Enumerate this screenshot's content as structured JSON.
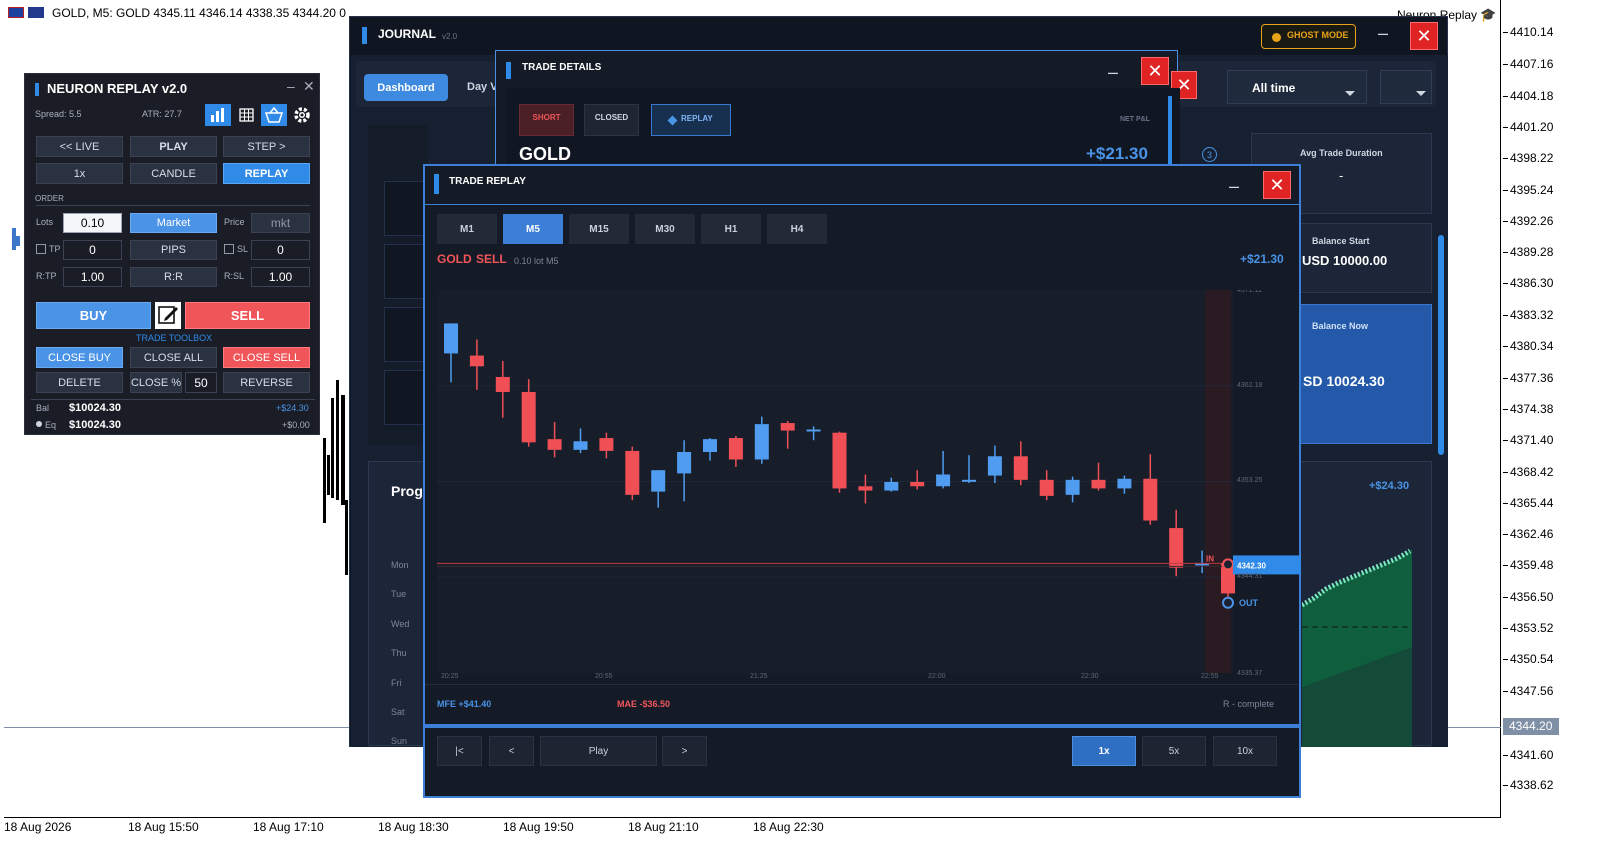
{
  "mt": {
    "title": "GOLD, M5:  GOLD  4345.11 4346.14 4338.35 4344.20  0",
    "corner_label": "Neuron Replay",
    "current_price": "4344.20",
    "price_ticks": [
      "4410.14",
      "4407.16",
      "4404.18",
      "4401.20",
      "4398.22",
      "4395.24",
      "4392.26",
      "4389.28",
      "4386.30",
      "4383.32",
      "4380.34",
      "4377.36",
      "4374.38",
      "4371.40",
      "4368.42",
      "4365.44",
      "4362.46",
      "4359.48",
      "4356.50",
      "4353.52",
      "4350.54",
      "4347.56",
      "4341.60",
      "4338.62"
    ],
    "time_ticks": [
      "18 Aug 2026",
      "18 Aug 15:50",
      "18 Aug 17:10",
      "18 Aug 18:30",
      "18 Aug 19:50",
      "18 Aug 21:10",
      "18 Aug 22:30"
    ]
  },
  "neuron": {
    "title": "NEURON REPLAY v2.0",
    "spread": "Spread: 5.5",
    "atr": "ATR: 27.7",
    "btn_live": "<< LIVE",
    "btn_play": "PLAY",
    "btn_step": "STEP >",
    "btn_speed": "1x",
    "btn_candle": "CANDLE",
    "btn_replay": "REPLAY",
    "order_label": "ORDER",
    "lots_label": "Lots",
    "lots_value": "0.10",
    "market_btn": "Market",
    "price_label": "Price",
    "price_value": "mkt",
    "tp_label": "TP",
    "tp_value": "0",
    "pips_btn": "PIPS",
    "sl_label": "SL",
    "sl_value": "0",
    "rtp_label": "R:TP",
    "rtp_value": "1.00",
    "rr_btn": "R:R",
    "rsl_label": "R:SL",
    "rsl_value": "1.00",
    "buy": "BUY",
    "sell": "SELL",
    "toolbox": "TRADE TOOLBOX",
    "close_buy": "CLOSE BUY",
    "close_all": "CLOSE ALL",
    "close_sell": "CLOSE SELL",
    "delete": "DELETE",
    "close_pct": "CLOSE %",
    "close_pct_value": "50",
    "reverse": "REVERSE",
    "bal_label": "Bal",
    "bal_value": "$10024.30",
    "bal_pnl": "+$24.30",
    "eq_label": "Eq",
    "eq_value": "$10024.30",
    "eq_pnl": "+$0.00"
  },
  "journal": {
    "title": "JOURNAL",
    "version": "v2.0",
    "ghost_mode": "GHOST MODE",
    "tab_dashboard": "Dashboard",
    "tab_day": "Day V",
    "period": "All time",
    "avg_trade_duration_label": "Avg Trade Duration",
    "avg_trade_duration_value": "-",
    "balance_start_label": "Balance Start",
    "balance_start_value": "USD 10000.00",
    "balance_now_label": "Balance Now",
    "balance_now_value": "SD 10024.30",
    "progress_label": "Prog",
    "days": [
      "Mon",
      "Tue",
      "Wed",
      "Thu",
      "Fri",
      "Sat",
      "Sun"
    ],
    "equity_pnl": "+$24.30",
    "badge_count": "3"
  },
  "details": {
    "title": "TRADE DETAILS",
    "tag_short": "SHORT",
    "tag_closed": "CLOSED",
    "tag_replay": "REPLAY",
    "net_pnl_label": "NET P&L",
    "symbol": "GOLD",
    "net_pnl": "+$21.30"
  },
  "replay": {
    "title": "TRADE REPLAY",
    "timeframes": [
      "M1",
      "M5",
      "M15",
      "M30",
      "H1",
      "H4"
    ],
    "active_tf": "M5",
    "header_symbol": "GOLD",
    "header_side": "SELL",
    "header_meta": "0.10 lot  M5",
    "header_pnl": "+$21.30",
    "mfe": "MFE +$41.40",
    "mae": "MAE -$36.50",
    "status": "R -   complete",
    "ctl_start": "|<",
    "ctl_prev": "<",
    "ctl_play": "Play",
    "ctl_next": ">",
    "speeds": [
      "1x",
      "5x",
      "10x"
    ],
    "in_label": "IN",
    "out_label": "OUT",
    "price_tag": "4342.30",
    "axis_prices": [
      "4371.12",
      "4362.18",
      "4353.25",
      "4344.31",
      "4335.37"
    ],
    "axis_times": [
      "20:25",
      "20:55",
      "21:25",
      "22:00",
      "22:30",
      "22:55"
    ]
  },
  "chart_data": {
    "type": "candlestick",
    "title": "",
    "ylim": [
      4335.37,
      4371.12
    ],
    "entry_price": 4345.6,
    "exit_price": 4342.3,
    "candles": [
      {
        "o": 4365.2,
        "h": 4366.6,
        "l": 4362.5,
        "c": 4368.0
      },
      {
        "o": 4365.0,
        "h": 4366.5,
        "l": 4361.8,
        "c": 4364.0
      },
      {
        "o": 4363.0,
        "h": 4364.5,
        "l": 4359.2,
        "c": 4361.6
      },
      {
        "o": 4361.6,
        "h": 4362.8,
        "l": 4356.5,
        "c": 4356.9
      },
      {
        "o": 4357.2,
        "h": 4358.8,
        "l": 4355.5,
        "c": 4356.2
      },
      {
        "o": 4356.2,
        "h": 4358.2,
        "l": 4355.9,
        "c": 4357.0
      },
      {
        "o": 4357.3,
        "h": 4357.8,
        "l": 4355.4,
        "c": 4356.1
      },
      {
        "o": 4356.1,
        "h": 4356.5,
        "l": 4351.5,
        "c": 4352.0
      },
      {
        "o": 4352.3,
        "h": 4352.5,
        "l": 4350.8,
        "c": 4354.3
      },
      {
        "o": 4354.0,
        "h": 4357.1,
        "l": 4351.4,
        "c": 4356.0
      },
      {
        "o": 4356.0,
        "h": 4357.3,
        "l": 4355.2,
        "c": 4357.2
      },
      {
        "o": 4357.3,
        "h": 4357.5,
        "l": 4354.6,
        "c": 4355.3
      },
      {
        "o": 4355.3,
        "h": 4359.3,
        "l": 4354.9,
        "c": 4358.6
      },
      {
        "o": 4358.7,
        "h": 4358.9,
        "l": 4356.3,
        "c": 4358.0
      },
      {
        "o": 4358.0,
        "h": 4358.4,
        "l": 4357.1,
        "c": 4358.1
      },
      {
        "o": 4357.8,
        "h": 4357.9,
        "l": 4352.2,
        "c": 4352.6
      },
      {
        "o": 4352.8,
        "h": 4353.9,
        "l": 4351.2,
        "c": 4352.4
      },
      {
        "o": 4352.4,
        "h": 4353.6,
        "l": 4352.3,
        "c": 4353.2
      },
      {
        "o": 4353.2,
        "h": 4354.3,
        "l": 4352.5,
        "c": 4352.8
      },
      {
        "o": 4352.8,
        "h": 4356.1,
        "l": 4352.6,
        "c": 4353.9
      },
      {
        "o": 4353.4,
        "h": 4355.7,
        "l": 4353.1,
        "c": 4353.4
      },
      {
        "o": 4353.8,
        "h": 4356.6,
        "l": 4353.1,
        "c": 4355.6
      },
      {
        "o": 4355.6,
        "h": 4357.0,
        "l": 4352.9,
        "c": 4353.4
      },
      {
        "o": 4353.4,
        "h": 4354.3,
        "l": 4351.5,
        "c": 4351.9
      },
      {
        "o": 4352.0,
        "h": 4353.7,
        "l": 4351.3,
        "c": 4353.4
      },
      {
        "o": 4353.4,
        "h": 4355.0,
        "l": 4352.4,
        "c": 4352.6
      },
      {
        "o": 4352.6,
        "h": 4353.8,
        "l": 4352.1,
        "c": 4353.5
      },
      {
        "o": 4353.5,
        "h": 4355.8,
        "l": 4349.2,
        "c": 4349.6
      },
      {
        "o": 4348.9,
        "h": 4350.6,
        "l": 4344.4,
        "c": 4345.2
      },
      {
        "o": 4345.5,
        "h": 4346.8,
        "l": 4344.7,
        "c": 4345.6
      },
      {
        "o": 4345.6,
        "h": 4345.7,
        "l": 4342.3,
        "c": 4342.8
      }
    ]
  },
  "colors": {
    "bull": "#4f9cf0",
    "bear": "#ef4f55",
    "accent": "#2f8ae8"
  }
}
